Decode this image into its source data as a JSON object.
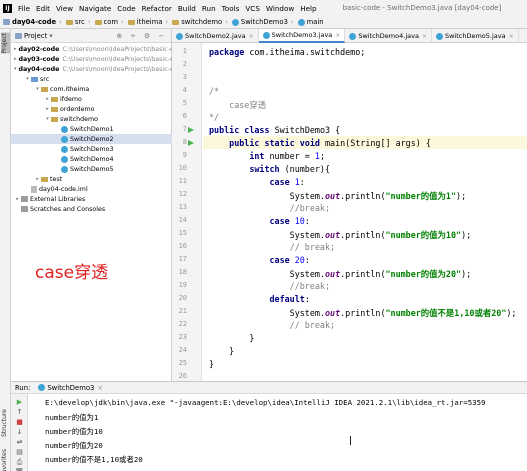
{
  "menu": {
    "logo": "IJ",
    "items": [
      "File",
      "Edit",
      "View",
      "Navigate",
      "Code",
      "Refactor",
      "Build",
      "Run",
      "Tools",
      "VCS",
      "Window",
      "Help"
    ],
    "window_title": "basic-code - SwitchDemo3.java [day04-code]"
  },
  "breadcrumb": [
    "day04-code",
    "src",
    "com",
    "itheima",
    "switchdemo",
    "SwitchDemo3",
    "main"
  ],
  "side_tabs": [
    "Project",
    "Structure",
    "Favorites"
  ],
  "project": {
    "header": "Project",
    "tools": "⊕ ÷ ⚙ −",
    "tree": [
      {
        "label": "day02-code",
        "path": "C:\\Users\\moon\\IdeaProjects\\basic-co",
        "arrow": "▸",
        "icon": "mod",
        "depth": 0,
        "bold": true
      },
      {
        "label": "day03-code",
        "path": "C:\\Users\\moon\\IdeaProjects\\basic-co",
        "arrow": "▸",
        "icon": "mod",
        "depth": 0,
        "bold": true
      },
      {
        "label": "day04-code",
        "path": "C:\\Users\\moon\\IdeaProjects\\basic-co",
        "arrow": "▾",
        "icon": "mod",
        "depth": 0,
        "bold": true
      },
      {
        "label": "src",
        "path": "",
        "arrow": "▾",
        "icon": "src",
        "depth": 1
      },
      {
        "label": "com.itheima",
        "path": "",
        "arrow": "▾",
        "icon": "folder",
        "depth": 2
      },
      {
        "label": "ifdemo",
        "path": "",
        "arrow": "▸",
        "icon": "folder",
        "depth": 3
      },
      {
        "label": "orderdemo",
        "path": "",
        "arrow": "▸",
        "icon": "folder",
        "depth": 3
      },
      {
        "label": "switchdemo",
        "path": "",
        "arrow": "▾",
        "icon": "folder",
        "depth": 3
      },
      {
        "label": "SwitchDemo1",
        "path": "",
        "arrow": "",
        "icon": "java",
        "depth": 4
      },
      {
        "label": "SwitchDemo2",
        "path": "",
        "arrow": "",
        "icon": "java",
        "depth": 4,
        "selected": true
      },
      {
        "label": "SwitchDemo3",
        "path": "",
        "arrow": "",
        "icon": "java",
        "depth": 4
      },
      {
        "label": "SwitchDemo4",
        "path": "",
        "arrow": "",
        "icon": "java",
        "depth": 4
      },
      {
        "label": "SwitchDemo5",
        "path": "",
        "arrow": "",
        "icon": "java",
        "depth": 4
      },
      {
        "label": "test",
        "path": "",
        "arrow": "▸",
        "icon": "folder",
        "depth": 2
      },
      {
        "label": "day04-code.iml",
        "path": "",
        "arrow": "",
        "icon": "iml",
        "depth": 1
      },
      {
        "label": "External Libraries",
        "path": "",
        "arrow": "▸",
        "icon": "lib",
        "depth": 0
      },
      {
        "label": "Scratches and Consoles",
        "path": "",
        "arrow": "",
        "icon": "lib",
        "depth": 0
      }
    ]
  },
  "annotation": "case穿透",
  "editor": {
    "tabs": [
      {
        "label": "SwitchDemo2.java",
        "active": false
      },
      {
        "label": "SwitchDemo3.java",
        "active": true
      },
      {
        "label": "SwitchDemo4.java",
        "active": false
      },
      {
        "label": "SwitchDemo5.java",
        "active": false
      }
    ],
    "line_numbers": [
      "1",
      "2",
      "3",
      "4",
      "5",
      "6",
      "7",
      "8",
      "9",
      "10",
      "11",
      "12",
      "13",
      "14",
      "15",
      "16",
      "17",
      "18",
      "19",
      "20",
      "21",
      "22",
      "23",
      "24",
      "25",
      "26"
    ],
    "run_gutter_lines": [
      7,
      8
    ],
    "current_line": 8,
    "lines": [
      [
        {
          "t": "package ",
          "c": "kw"
        },
        {
          "t": "com.itheima.switchdemo;",
          "c": ""
        }
      ],
      [],
      [],
      [
        {
          "t": "/*",
          "c": "cmt"
        }
      ],
      [
        {
          "t": "    case穿透",
          "c": "cmt"
        }
      ],
      [
        {
          "t": "*/",
          "c": "cmt"
        }
      ],
      [
        {
          "t": "public class ",
          "c": "kw"
        },
        {
          "t": "SwitchDemo3 {",
          "c": ""
        }
      ],
      [
        {
          "t": "    public static void ",
          "c": "kw"
        },
        {
          "t": "main(String[] args) {",
          "c": ""
        }
      ],
      [
        {
          "t": "        int ",
          "c": "kw"
        },
        {
          "t": "number = ",
          "c": ""
        },
        {
          "t": "1",
          "c": "num"
        },
        {
          "t": ";",
          "c": ""
        }
      ],
      [
        {
          "t": "        switch ",
          "c": "kw"
        },
        {
          "t": "(number){",
          "c": ""
        }
      ],
      [
        {
          "t": "            case ",
          "c": "kw"
        },
        {
          "t": "1",
          "c": "num"
        },
        {
          "t": ":",
          "c": ""
        }
      ],
      [
        {
          "t": "                System.",
          "c": ""
        },
        {
          "t": "out",
          "c": "out"
        },
        {
          "t": ".println(",
          "c": ""
        },
        {
          "t": "\"number的值为1\"",
          "c": "str"
        },
        {
          "t": ");",
          "c": ""
        }
      ],
      [
        {
          "t": "                //break;",
          "c": "cmt"
        }
      ],
      [
        {
          "t": "            case ",
          "c": "kw"
        },
        {
          "t": "10",
          "c": "num"
        },
        {
          "t": ":",
          "c": ""
        }
      ],
      [
        {
          "t": "                System.",
          "c": ""
        },
        {
          "t": "out",
          "c": "out"
        },
        {
          "t": ".println(",
          "c": ""
        },
        {
          "t": "\"number的值为10\"",
          "c": "str"
        },
        {
          "t": ");",
          "c": ""
        }
      ],
      [
        {
          "t": "                // break;",
          "c": "cmt"
        }
      ],
      [
        {
          "t": "            case ",
          "c": "kw"
        },
        {
          "t": "20",
          "c": "num"
        },
        {
          "t": ":",
          "c": ""
        }
      ],
      [
        {
          "t": "                System.",
          "c": ""
        },
        {
          "t": "out",
          "c": "out"
        },
        {
          "t": ".println(",
          "c": ""
        },
        {
          "t": "\"number的值为20\"",
          "c": "str"
        },
        {
          "t": ");",
          "c": ""
        }
      ],
      [
        {
          "t": "                //break;",
          "c": "cmt"
        }
      ],
      [
        {
          "t": "            default",
          "c": "kw"
        },
        {
          "t": ":",
          "c": ""
        }
      ],
      [
        {
          "t": "                System.",
          "c": ""
        },
        {
          "t": "out",
          "c": "out"
        },
        {
          "t": ".println(",
          "c": ""
        },
        {
          "t": "\"number的值不是1,10或者20\"",
          "c": "str"
        },
        {
          "t": ");",
          "c": ""
        }
      ],
      [
        {
          "t": "                // break;",
          "c": "cmt"
        }
      ],
      [
        {
          "t": "        }",
          "c": ""
        }
      ],
      [
        {
          "t": "    }",
          "c": ""
        }
      ],
      [
        {
          "t": "}",
          "c": ""
        }
      ],
      []
    ]
  },
  "run": {
    "label": "Run:",
    "tab": "SwitchDemo3",
    "tools": [
      "▶",
      "↑",
      "■",
      "↓",
      "⇌",
      "▤",
      "⎙",
      "🗑"
    ],
    "console": [
      "E:\\develop\\jdk\\bin\\java.exe \"-javaagent:E:\\develop\\idea\\IntelliJ IDEA 2021.2.1\\lib\\idea_rt.jar=5359",
      "number的值为1",
      "number的值为10",
      "number的值为20",
      "number的值不是1,10或者20"
    ]
  }
}
